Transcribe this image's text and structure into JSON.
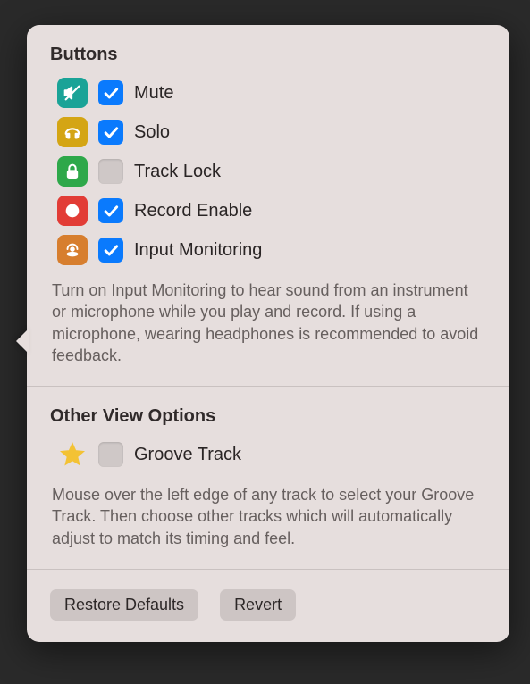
{
  "sections": {
    "buttons": {
      "title": "Buttons",
      "items": [
        {
          "label": "Mute",
          "checked": true
        },
        {
          "label": "Solo",
          "checked": true
        },
        {
          "label": "Track Lock",
          "checked": false
        },
        {
          "label": "Record Enable",
          "checked": true
        },
        {
          "label": "Input Monitoring",
          "checked": true
        }
      ],
      "description": "Turn on Input Monitoring to hear sound from an instrument or microphone while you play and record. If using a microphone, wearing headphones is recommended to avoid feedback."
    },
    "other": {
      "title": "Other View Options",
      "items": [
        {
          "label": "Groove Track",
          "checked": false
        }
      ],
      "description": "Mouse over the left edge of any track to select your Groove Track. Then choose other tracks which will automatically adjust to match its timing and feel."
    }
  },
  "actions": {
    "restore": "Restore Defaults",
    "revert": "Revert"
  }
}
